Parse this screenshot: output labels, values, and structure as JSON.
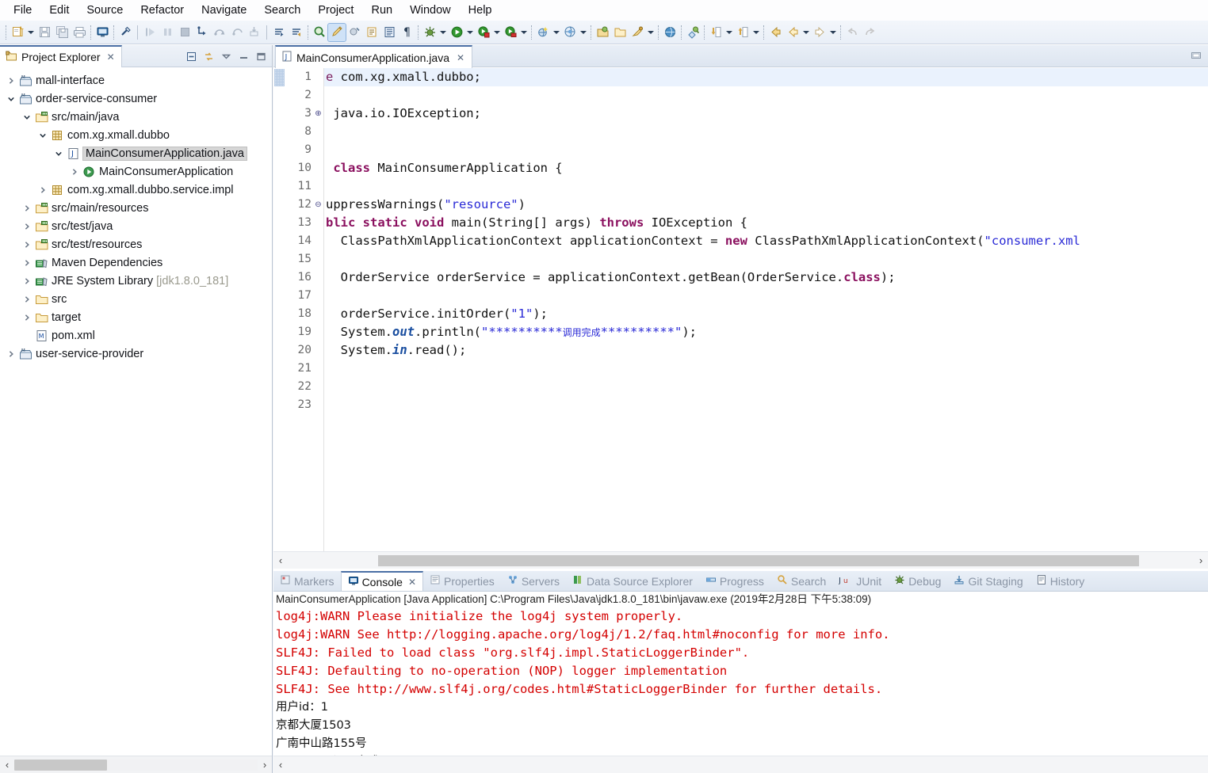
{
  "menu": {
    "items": [
      {
        "label": "File"
      },
      {
        "label": "Edit"
      },
      {
        "label": "Source"
      },
      {
        "label": "Refactor"
      },
      {
        "label": "Navigate"
      },
      {
        "label": "Search"
      },
      {
        "label": "Project"
      },
      {
        "label": "Run"
      },
      {
        "label": "Window"
      },
      {
        "label": "Help"
      }
    ]
  },
  "toolbar": {
    "icons": [
      "new-wizard-icon",
      "new-dropdown-arrow",
      "save-icon",
      "save-all-icon",
      "print-icon",
      "toggle-console-icon",
      "link-break-icon",
      "resume-icon",
      "suspend-icon",
      "terminate-icon",
      "step-into-icon",
      "step-over-icon",
      "step-return-icon",
      "drop-to-frame-icon",
      "next-annotation-icon",
      "previous-annotation-icon",
      "toggle-mark-occurrences-icon",
      "java-editor-icon",
      "new-java-class-icon",
      "new-java-package-icon",
      "open-type-icon",
      "show-whitespace-icon",
      "debug-icon",
      "debug-dropdown-arrow",
      "run-icon",
      "run-dropdown-arrow",
      "run-as-server-icon",
      "run-as-server-dropdown-arrow",
      "stop-server-icon",
      "stop-server-dropdown-arrow",
      "new-web-project-icon",
      "new-web-dropdown-arrow",
      "search-web-icon",
      "search-web-dropdown-arrow",
      "open-perspective-icon",
      "open-folder-icon",
      "maven-build-icon",
      "maven-dropdown-arrow",
      "open-web-browser-icon",
      "external-tools-icon",
      "import-icon",
      "import-dropdown-arrow",
      "export-icon",
      "export-dropdown-arrow",
      "back-icon",
      "back-history-icon",
      "back-history-dropdown-arrow",
      "forward-icon",
      "forward-dropdown-arrow",
      "undo-icon",
      "redo-icon"
    ]
  },
  "project_explorer": {
    "title": "Project Explorer",
    "close_glyph": "✕",
    "view_icons": [
      "collapse-all-icon",
      "link-with-editor-icon",
      "view-menu-icon",
      "minimize-icon",
      "maximize-icon"
    ],
    "tree": [
      {
        "label": "mall-interface",
        "indent": 0,
        "icon": "maven-project-icon",
        "state": "collapsed",
        "selected": false
      },
      {
        "label": "order-service-consumer",
        "indent": 0,
        "icon": "maven-project-icon",
        "state": "expanded",
        "selected": false
      },
      {
        "label": "src/main/java",
        "indent": 1,
        "icon": "source-folder-icon",
        "state": "expanded",
        "selected": false
      },
      {
        "label": "com.xg.xmall.dubbo",
        "indent": 2,
        "icon": "package-icon",
        "state": "expanded",
        "selected": false
      },
      {
        "label": "MainConsumerApplication.java",
        "indent": 3,
        "icon": "java-file-icon",
        "state": "expanded",
        "selected": true
      },
      {
        "label": "MainConsumerApplication",
        "indent": 4,
        "icon": "java-class-run-icon",
        "state": "collapsed",
        "selected": false
      },
      {
        "label": "com.xg.xmall.dubbo.service.impl",
        "indent": 2,
        "icon": "package-icon",
        "state": "collapsed",
        "selected": false
      },
      {
        "label": "src/main/resources",
        "indent": 1,
        "icon": "source-folder-icon",
        "state": "collapsed",
        "selected": false
      },
      {
        "label": "src/test/java",
        "indent": 1,
        "icon": "source-folder-icon",
        "state": "collapsed",
        "selected": false
      },
      {
        "label": "src/test/resources",
        "indent": 1,
        "icon": "source-folder-icon",
        "state": "collapsed",
        "selected": false
      },
      {
        "label": "Maven Dependencies",
        "indent": 1,
        "icon": "library-icon",
        "state": "collapsed",
        "selected": false
      },
      {
        "label": "JRE System Library",
        "suffix": " [jdk1.8.0_181]",
        "indent": 1,
        "icon": "library-icon",
        "state": "collapsed",
        "selected": false
      },
      {
        "label": "src",
        "indent": 1,
        "icon": "folder-icon",
        "state": "collapsed",
        "selected": false
      },
      {
        "label": "target",
        "indent": 1,
        "icon": "folder-icon",
        "state": "collapsed",
        "selected": false
      },
      {
        "label": "pom.xml",
        "indent": 1,
        "icon": "maven-pom-icon",
        "state": "leaf",
        "selected": false
      },
      {
        "label": "user-service-provider",
        "indent": 0,
        "icon": "maven-project-icon",
        "state": "collapsed",
        "selected": false
      }
    ]
  },
  "editor": {
    "tab": {
      "label": "MainConsumerApplication.java",
      "icon": "java-file-icon",
      "close_glyph": "✕"
    },
    "minimize_icon": "restore-icon",
    "scrolled_horizontally": true,
    "lines": [
      {
        "num": "1",
        "fold": "",
        "current": true,
        "tokens": [
          {
            "t": "e ",
            "c": "ann"
          },
          {
            "t": "com.xg.xmall.dubbo;",
            "c": "plain"
          }
        ]
      },
      {
        "num": "2",
        "fold": "",
        "current": false,
        "tokens": []
      },
      {
        "num": "3",
        "fold": "⊕",
        "current": false,
        "tokens": [
          {
            "t": " java.io.IOException;",
            "c": "plain"
          }
        ]
      },
      {
        "num": "8",
        "fold": "",
        "current": false,
        "tokens": []
      },
      {
        "num": "9",
        "fold": "",
        "current": false,
        "tokens": []
      },
      {
        "num": "10",
        "fold": "",
        "current": false,
        "tokens": [
          {
            "t": " ",
            "c": "plain"
          },
          {
            "t": "class",
            "c": "kw"
          },
          {
            "t": " MainConsumerApplication {",
            "c": "plain"
          }
        ]
      },
      {
        "num": "11",
        "fold": "",
        "current": false,
        "tokens": []
      },
      {
        "num": "12",
        "fold": "⊖",
        "current": false,
        "tokens": [
          {
            "t": "uppressWarnings(",
            "c": "plain"
          },
          {
            "t": "\"resource\"",
            "c": "str"
          },
          {
            "t": ")",
            "c": "plain"
          }
        ]
      },
      {
        "num": "13",
        "fold": "",
        "current": false,
        "tokens": [
          {
            "t": "blic",
            "c": "kw"
          },
          {
            "t": " ",
            "c": "plain"
          },
          {
            "t": "static",
            "c": "kw"
          },
          {
            "t": " ",
            "c": "plain"
          },
          {
            "t": "void",
            "c": "kw"
          },
          {
            "t": " main(String[] args) ",
            "c": "plain"
          },
          {
            "t": "throws",
            "c": "kw"
          },
          {
            "t": " IOException {",
            "c": "plain"
          }
        ]
      },
      {
        "num": "14",
        "fold": "",
        "current": false,
        "tokens": [
          {
            "t": "  ClassPathXmlApplicationContext applicationContext = ",
            "c": "plain"
          },
          {
            "t": "new",
            "c": "kw"
          },
          {
            "t": " ClassPathXmlApplicationContext(",
            "c": "plain"
          },
          {
            "t": "\"consumer.xml",
            "c": "str"
          }
        ]
      },
      {
        "num": "15",
        "fold": "",
        "current": false,
        "tokens": []
      },
      {
        "num": "16",
        "fold": "",
        "current": false,
        "tokens": [
          {
            "t": "  OrderService orderService = applicationContext.getBean(OrderService.",
            "c": "plain"
          },
          {
            "t": "class",
            "c": "kw"
          },
          {
            "t": ");",
            "c": "plain"
          }
        ]
      },
      {
        "num": "17",
        "fold": "",
        "current": false,
        "tokens": []
      },
      {
        "num": "18",
        "fold": "",
        "current": false,
        "tokens": [
          {
            "t": "  orderService.initOrder(",
            "c": "plain"
          },
          {
            "t": "\"1\"",
            "c": "str"
          },
          {
            "t": ");",
            "c": "plain"
          }
        ]
      },
      {
        "num": "19",
        "fold": "",
        "current": false,
        "tokens": [
          {
            "t": "  System.",
            "c": "plain"
          },
          {
            "t": "out",
            "c": "fld"
          },
          {
            "t": ".println(",
            "c": "plain"
          },
          {
            "t": "\"**********",
            "c": "str"
          },
          {
            "t": "调用完成",
            "c": "str cjk"
          },
          {
            "t": "**********\"",
            "c": "str"
          },
          {
            "t": ");",
            "c": "plain"
          }
        ]
      },
      {
        "num": "20",
        "fold": "",
        "current": false,
        "tokens": [
          {
            "t": "  System.",
            "c": "plain"
          },
          {
            "t": "in",
            "c": "fld"
          },
          {
            "t": ".read();",
            "c": "plain"
          }
        ]
      },
      {
        "num": "21",
        "fold": "",
        "current": false,
        "tokens": []
      },
      {
        "num": "22",
        "fold": "",
        "current": false,
        "tokens": []
      },
      {
        "num": "23",
        "fold": "",
        "current": false,
        "tokens": []
      }
    ]
  },
  "console_panel": {
    "tabs": [
      {
        "label": "Markers",
        "icon": "markers-icon",
        "active": false
      },
      {
        "label": "Console",
        "icon": "console-icon",
        "active": true
      },
      {
        "label": "Properties",
        "icon": "properties-icon",
        "active": false
      },
      {
        "label": "Servers",
        "icon": "servers-icon",
        "active": false
      },
      {
        "label": "Data Source Explorer",
        "icon": "datasource-icon",
        "active": false
      },
      {
        "label": "Progress",
        "icon": "progress-icon",
        "active": false
      },
      {
        "label": "Search",
        "icon": "search-icon",
        "active": false
      },
      {
        "label": "JUnit",
        "icon": "junit-icon",
        "active": false
      },
      {
        "label": "Debug",
        "icon": "debug-icon",
        "active": false
      },
      {
        "label": "Git Staging",
        "icon": "git-staging-icon",
        "active": false
      },
      {
        "label": "History",
        "icon": "history-icon",
        "active": false
      }
    ],
    "launch_header": "MainConsumerApplication [Java Application] C:\\Program Files\\Java\\jdk1.8.0_181\\bin\\javaw.exe (2019年2月28日 下午5:38:09)",
    "output": [
      {
        "kind": "err",
        "text": "log4j:WARN Please initialize the log4j system properly."
      },
      {
        "kind": "err",
        "text": "log4j:WARN See http://logging.apache.org/log4j/1.2/faq.html#noconfig for more info."
      },
      {
        "kind": "err",
        "text": "SLF4J: Failed to load class \"org.slf4j.impl.StaticLoggerBinder\"."
      },
      {
        "kind": "err",
        "text": "SLF4J: Defaulting to no-operation (NOP) logger implementation"
      },
      {
        "kind": "err",
        "text": "SLF4J: See http://www.slf4j.org/codes.html#StaticLoggerBinder for further details."
      },
      {
        "kind": "out",
        "text": "用户id：1"
      },
      {
        "kind": "out",
        "text": "京都大厦1503"
      },
      {
        "kind": "out",
        "text": "广南中山路155号"
      },
      {
        "kind": "out",
        "text": "**********调用完成**********"
      }
    ]
  },
  "colors": {
    "accent": "#4a6fa5",
    "error_text": "#d40000",
    "keyword": "#8a0f5e",
    "string": "#2a2ad6",
    "field": "#1b4fa0",
    "selection": "#d6d6d6",
    "current_line": "#eaf2fd"
  },
  "scrollbars": {
    "left_thumb_glyphs": {
      "left": "‹",
      "right": "›"
    },
    "editor_thumb_glyphs": {
      "left": "‹",
      "right": "›"
    }
  }
}
